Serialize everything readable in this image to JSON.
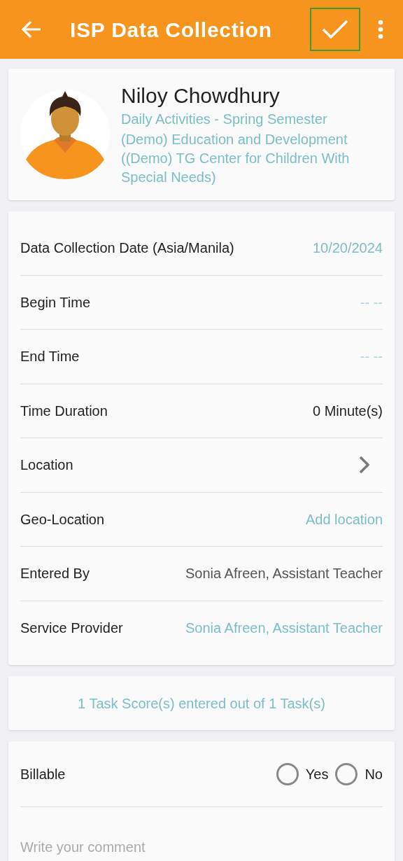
{
  "app_bar": {
    "title": "ISP Data Collection",
    "confirm_highlighted": true
  },
  "profile": {
    "name": "Niloy Chowdhury",
    "program": "Daily Activities - Spring Semester",
    "details": "(Demo) Education and Development ((Demo) TG Center for Children With Special Needs)"
  },
  "fields": [
    {
      "label": "Data Collection Date (Asia/Manila)",
      "kind": "link",
      "value": "10/20/2024"
    },
    {
      "label": "Begin Time",
      "kind": "empty",
      "value": "-- --"
    },
    {
      "label": "End Time",
      "kind": "empty",
      "value": "-- --"
    },
    {
      "label": "Time Duration",
      "kind": "plain",
      "value": "0 Minute(s)"
    },
    {
      "label": "Location",
      "kind": "chevron"
    },
    {
      "label": "Geo-Location",
      "kind": "link",
      "value": "Add location"
    },
    {
      "label": "Entered By",
      "kind": "muted",
      "value": "Sonia Afreen, Assistant Teacher"
    },
    {
      "label": "Service Provider",
      "kind": "link",
      "value": "Sonia Afreen, Assistant Teacher"
    }
  ],
  "task_summary": "1 Task Score(s) entered out of 1 Task(s)",
  "billable": {
    "label": "Billable",
    "options": [
      {
        "label": "Yes",
        "selected": false
      },
      {
        "label": "No",
        "selected": false
      }
    ]
  },
  "comment": {
    "placeholder": "Write your comment"
  }
}
